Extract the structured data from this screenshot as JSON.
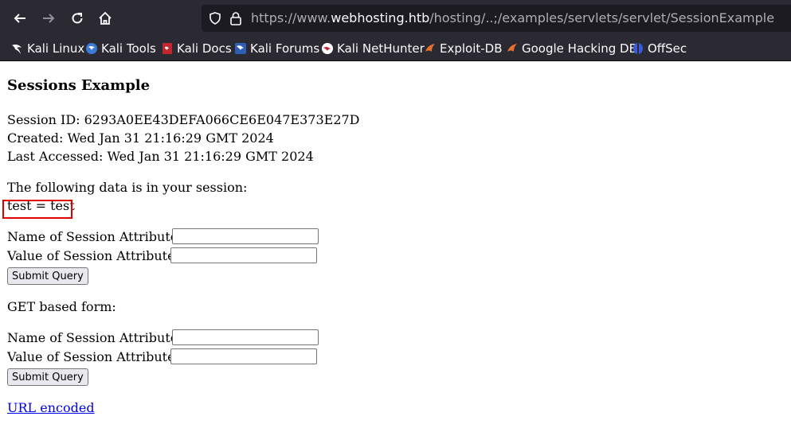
{
  "browser": {
    "url_prefix": "https://www.",
    "url_host": "webhosting.htb",
    "url_path": "/hosting/..;/examples/servlets/servlet/SessionExample",
    "bookmarks": [
      "Kali Linux",
      "Kali Tools",
      "Kali Docs",
      "Kali Forums",
      "Kali NetHunter",
      "Exploit-DB",
      "Google Hacking DB",
      "OffSec"
    ]
  },
  "page": {
    "heading": "Sessions Example",
    "session_id": "Session ID: 6293A0EE43DEFA066CE6E047E373E27D",
    "created": "Created: Wed Jan 31 21:16:29 GMT 2024",
    "last_accessed": "Last Accessed: Wed Jan 31 21:16:29 GMT 2024",
    "data_intro": "The following data is in your session:",
    "session_entry": "test = test",
    "name_label": "Name of Session Attribute:",
    "value_label": "Value of Session Attribute:",
    "submit_label": "Submit Query",
    "get_form_label": "GET based form:",
    "url_encoded": "URL encoded"
  },
  "colors": {
    "highlight": "#e00000",
    "link": "#0000ee"
  }
}
